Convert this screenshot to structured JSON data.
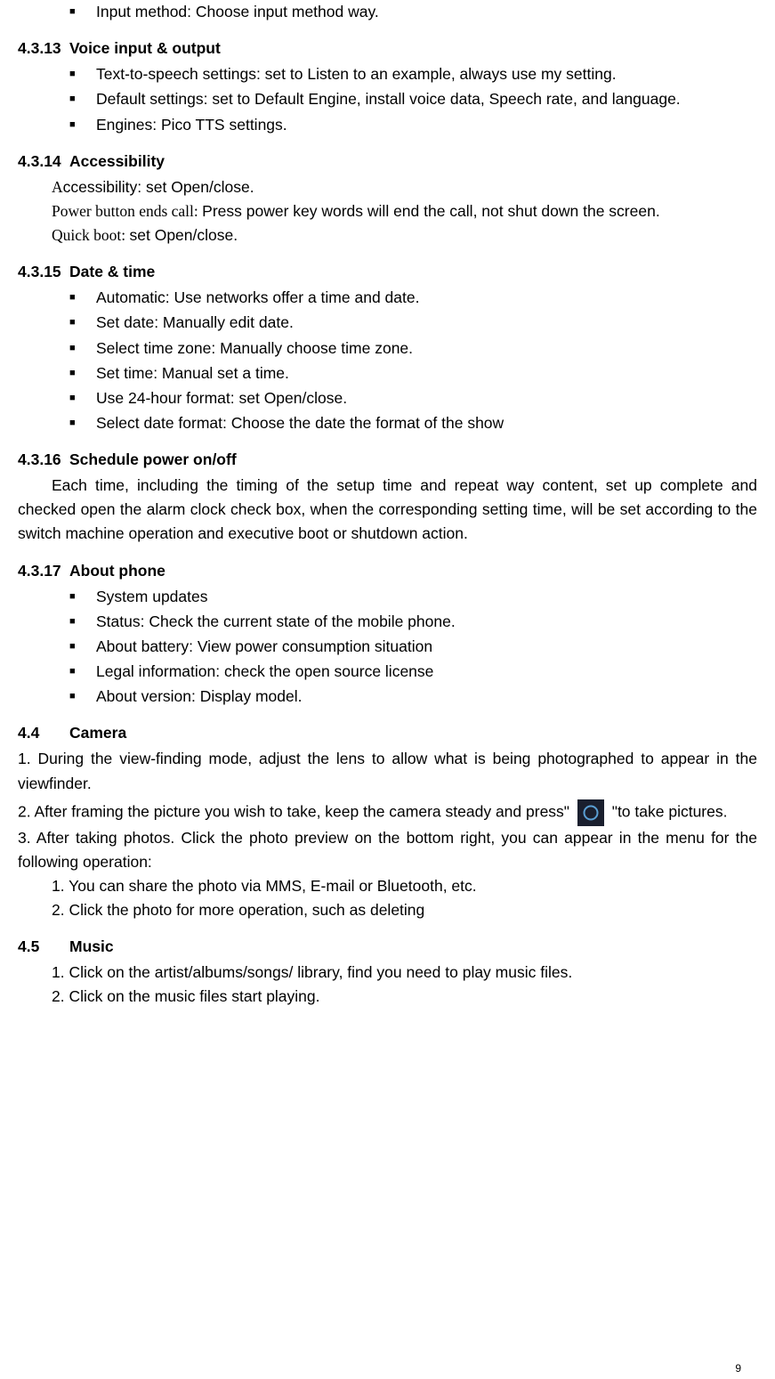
{
  "s_input_method": {
    "items": [
      "Input method: Choose input method way."
    ]
  },
  "s4313": {
    "num": "4.3.13",
    "title": "Voice input & output",
    "items": [
      "Text-to-speech settings: set to Listen to an example, always use my setting.",
      "Default settings: set to Default Engine, install voice data, Speech rate, and language.",
      "Engines: Pico TTS settings."
    ]
  },
  "s4314": {
    "num": "4.3.14",
    "title": "Accessibility",
    "lines": [
      {
        "serif": "A",
        "rest": "ccessibility: set Open/close."
      },
      {
        "serif": "Power button ends call: ",
        "rest": "Press power key words will end the call, not shut down the screen."
      },
      {
        "serif": "Quick boot: ",
        "rest": "set Open/close."
      }
    ]
  },
  "s4315": {
    "num": "4.3.15",
    "title": "Date & time",
    "items": [
      "Automatic: Use networks offer a time and date.",
      "Set date: Manually edit date.",
      "Select time zone: Manually choose time zone.",
      "Set time: Manual set a time.",
      "Use 24-hour format: set Open/close.",
      "Select date format: Choose the date the format of the show"
    ]
  },
  "s4316": {
    "num": "4.3.16",
    "title": "Schedule power on/off",
    "body": "Each time, including the timing of the setup time and repeat way content, set up complete and checked open the alarm clock check box, when the corresponding setting time, will be set according to the switch machine operation and executive boot or shutdown action."
  },
  "s4317": {
    "num": "4.3.17",
    "title": "About phone",
    "items": [
      "System updates",
      "Status: Check the current state of the mobile phone.",
      "About battery: View power consumption situation",
      "Legal information: check the open source license",
      "About version: Display model."
    ]
  },
  "s44": {
    "num": "4.4",
    "title": "Camera",
    "p1": "1. During the view-finding mode, adjust the lens to allow what is being photographed to appear in the viewfinder.",
    "p2a": "2. After framing the picture you wish to take, keep the camera steady and press\" ",
    "p2b": " \"to take pictures.",
    "p3": "3. After taking photos. Click the photo preview on the bottom right, you can appear in the menu for the following operation:",
    "sub": [
      "1. You can share the photo via MMS, E-mail or Bluetooth, etc.",
      "2. Click the photo for more operation, such as deleting"
    ]
  },
  "s45": {
    "num": "4.5",
    "title": "Music",
    "items": [
      "1. Click on the artist/albums/songs/ library, find you need to play music files.",
      "2. Click on the music files start playing."
    ]
  },
  "page_number": "9"
}
